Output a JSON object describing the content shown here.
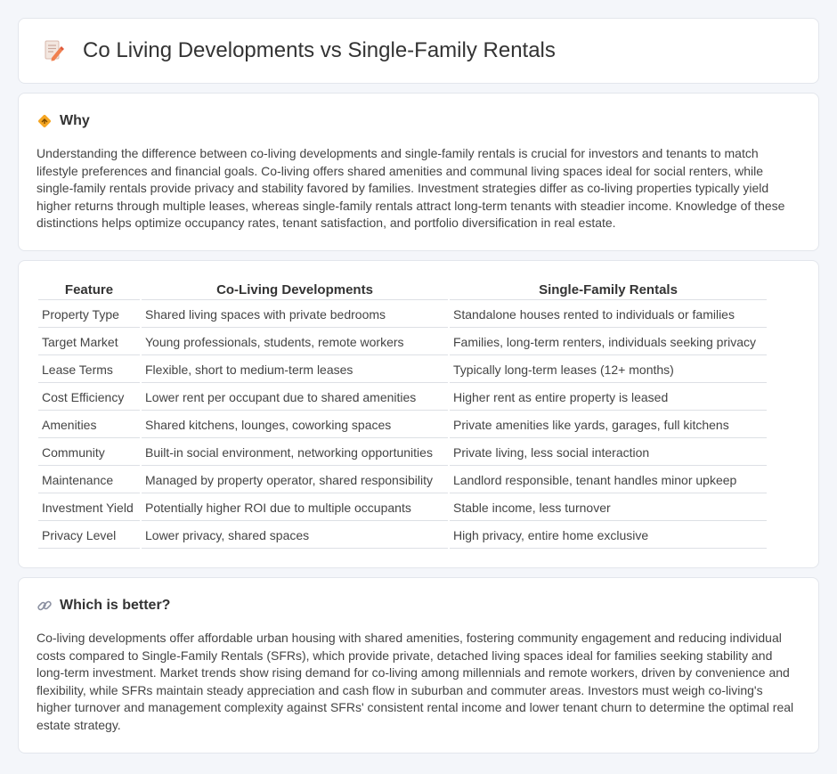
{
  "header": {
    "title": "Co Living Developments vs Single-Family Rentals",
    "icon": "document-pencil-icon"
  },
  "why": {
    "heading": "Why",
    "icon": "warning-diamond-icon",
    "text": "Understanding the difference between co-living developments and single-family rentals is crucial for investors and tenants to match lifestyle preferences and financial goals. Co-living offers shared amenities and communal living spaces ideal for social renters, while single-family rentals provide privacy and stability favored by families. Investment strategies differ as co-living properties typically yield higher returns through multiple leases, whereas single-family rentals attract long-term tenants with steadier income. Knowledge of these distinctions helps optimize occupancy rates, tenant satisfaction, and portfolio diversification in real estate."
  },
  "comparison": {
    "headers": [
      "Feature",
      "Co-Living Developments",
      "Single-Family Rentals"
    ],
    "rows": [
      [
        "Property Type",
        "Shared living spaces with private bedrooms",
        "Standalone houses rented to individuals or families"
      ],
      [
        "Target Market",
        "Young professionals, students, remote workers",
        "Families, long-term renters, individuals seeking privacy"
      ],
      [
        "Lease Terms",
        "Flexible, short to medium-term leases",
        "Typically long-term leases (12+ months)"
      ],
      [
        "Cost Efficiency",
        "Lower rent per occupant due to shared amenities",
        "Higher rent as entire property is leased"
      ],
      [
        "Amenities",
        "Shared kitchens, lounges, coworking spaces",
        "Private amenities like yards, garages, full kitchens"
      ],
      [
        "Community",
        "Built-in social environment, networking opportunities",
        "Private living, less social interaction"
      ],
      [
        "Maintenance",
        "Managed by property operator, shared responsibility",
        "Landlord responsible, tenant handles minor upkeep"
      ],
      [
        "Investment Yield",
        "Potentially higher ROI due to multiple occupants",
        "Stable income, less turnover"
      ],
      [
        "Privacy Level",
        "Lower privacy, shared spaces",
        "High privacy, entire home exclusive"
      ]
    ]
  },
  "which": {
    "heading": "Which is better?",
    "icon": "link-icon",
    "text": "Co-living developments offer affordable urban housing with shared amenities, fostering community engagement and reducing individual costs compared to Single-Family Rentals (SFRs), which provide private, detached living spaces ideal for families seeking stability and long-term investment. Market trends show rising demand for co-living among millennials and remote workers, driven by convenience and flexibility, while SFRs maintain steady appreciation and cash flow in suburban and commuter areas. Investors must weigh co-living's higher turnover and management complexity against SFRs' consistent rental income and lower tenant churn to determine the optimal real estate strategy."
  }
}
